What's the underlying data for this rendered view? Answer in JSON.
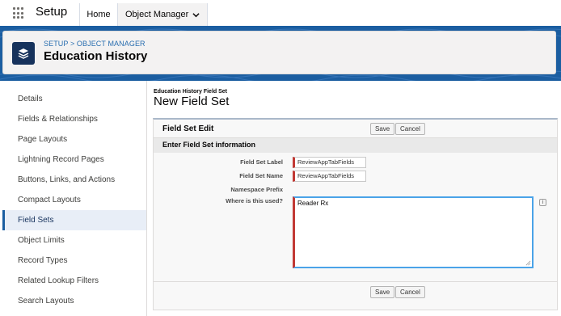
{
  "nav": {
    "app_name": "Setup",
    "tabs": [
      {
        "label": "Home"
      },
      {
        "label": "Object Manager"
      }
    ]
  },
  "header": {
    "breadcrumb": "SETUP > OBJECT MANAGER",
    "title": "Education History"
  },
  "sidebar": {
    "items": [
      {
        "label": "Details"
      },
      {
        "label": "Fields & Relationships"
      },
      {
        "label": "Page Layouts"
      },
      {
        "label": "Lightning Record Pages"
      },
      {
        "label": "Buttons, Links, and Actions"
      },
      {
        "label": "Compact Layouts"
      },
      {
        "label": "Field Sets"
      },
      {
        "label": "Object Limits"
      },
      {
        "label": "Record Types"
      },
      {
        "label": "Related Lookup Filters"
      },
      {
        "label": "Search Layouts"
      }
    ],
    "active": "Field Sets"
  },
  "main": {
    "overline": "Education History Field Set",
    "page_title": "New Field Set",
    "block_title": "Field Set Edit",
    "save_label": "Save",
    "cancel_label": "Cancel",
    "section_title": "Enter Field Set information",
    "fields": {
      "label_label": "Field Set Label",
      "label_value": "ReviewAppTabFields",
      "name_label": "Field Set Name",
      "name_value": "ReviewAppTabFields",
      "prefix_label": "Namespace Prefix",
      "where_label": "Where is this used?",
      "where_value": "Reader Rx"
    },
    "info_icon_glyph": "i"
  },
  "colors": {
    "brand_blue": "#1b5ea1",
    "required_red": "#c23934",
    "focus_blue": "#4aa3e8"
  },
  "icons": [
    "app-launcher-icon",
    "chevron-down-icon",
    "layers-icon",
    "info-icon",
    "resize-grip-icon"
  ]
}
